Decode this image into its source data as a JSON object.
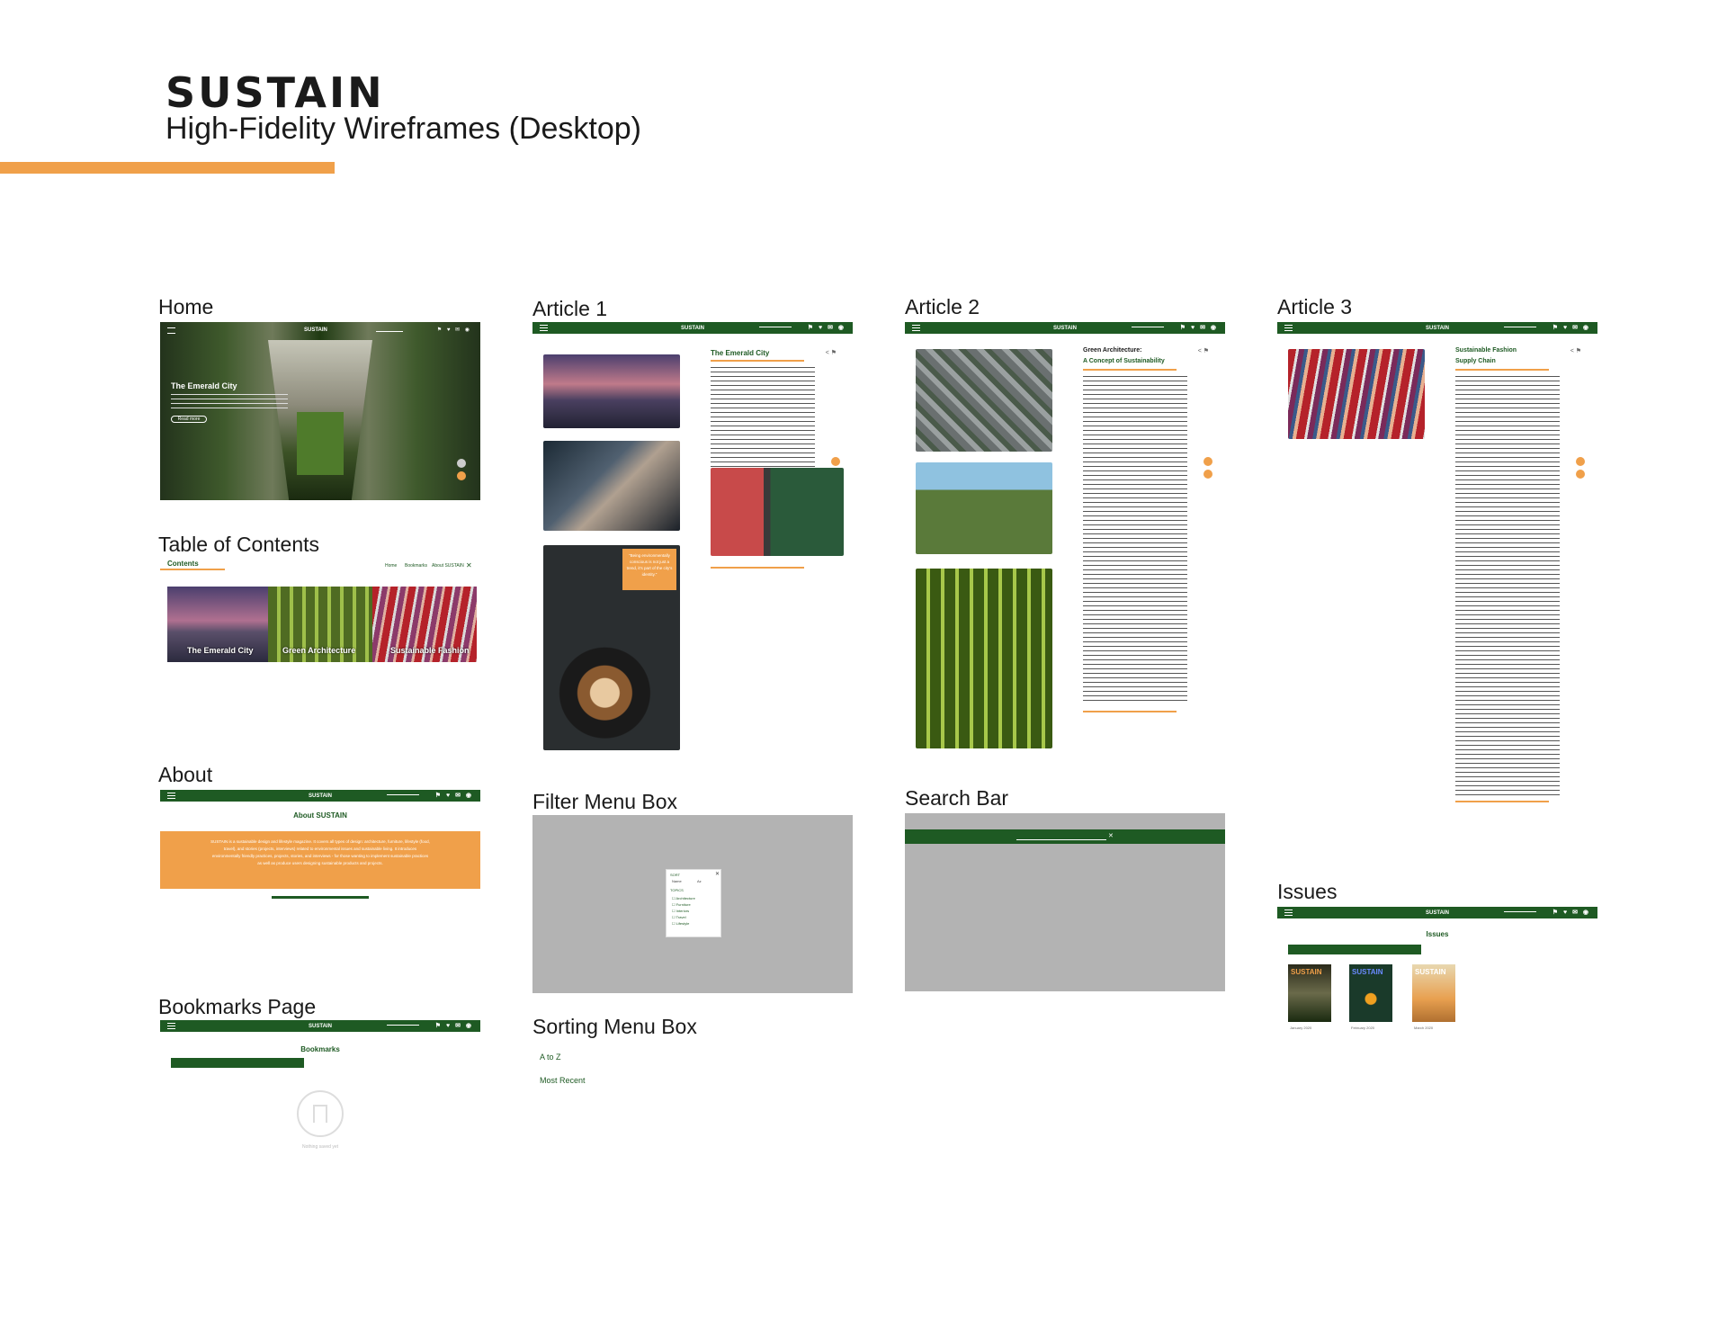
{
  "header": {
    "title": "SUSTAIN",
    "subtitle": "High-Fidelity Wireframes (Desktop)"
  },
  "sections": {
    "home": "Home",
    "toc": "Table of Contents",
    "about": "About",
    "bookmarks": "Bookmarks Page",
    "article1": "Article 1",
    "filter": "Filter Menu Box",
    "sorting": "Sorting Menu Box",
    "article2": "Article 2",
    "search": "Search Bar",
    "article3": "Article 3",
    "issues": "Issues"
  },
  "nav": {
    "brand": "SUSTAIN",
    "icons": "⚑ ♥ ✉ ◉"
  },
  "home": {
    "hero_title": "The Emerald City",
    "button": "Read more"
  },
  "toc": {
    "label": "Contents",
    "links": [
      "Home",
      "Bookmarks",
      "About SUSTAIN"
    ],
    "close": "✕",
    "cards": [
      "The Emerald City",
      "Green Architecture",
      "Sustainable Fashion"
    ]
  },
  "about": {
    "title": "About SUSTAIN",
    "body": "SUSTAIN is a sustainable design and lifestyle magazine. It covers all types of design: architecture, furniture, lifestyle (food, travel), and stories (projects, interviews) related to environmental issues and sustainable living. It introduces environmentally friendly practices, projects, stories, and interviews - for those wanting to implement sustainable practices as well as produce users designing sustainable products and projects."
  },
  "bookmarks": {
    "title": "Bookmarks",
    "empty": "Nothing saved yet"
  },
  "article1": {
    "title": "The Emerald City",
    "quote": "\"Being environmentally conscious is not just a trend, it's part of the city's identity.\""
  },
  "filter": {
    "sort_label": "SORT",
    "sort_opt1": "Name",
    "sort_opt2": "Az",
    "topic_label": "TOPICS",
    "options": [
      "Architecture",
      "Furniture",
      "Interiors",
      "Travel",
      "Lifestyle"
    ],
    "close": "✕"
  },
  "sorting": {
    "options": [
      "A to Z",
      "Most Recent"
    ]
  },
  "article2": {
    "title_line1": "Green Architecture:",
    "title_line2": "A Concept of Sustainability"
  },
  "search": {
    "close": "✕"
  },
  "article3": {
    "title_line1": "Sustainable Fashion",
    "title_line2": "Supply Chain"
  },
  "issues": {
    "title": "Issues",
    "covers": [
      {
        "brand": "SUSTAIN",
        "date": "January 2020"
      },
      {
        "brand": "SUSTAIN",
        "date": "February 2020"
      },
      {
        "brand": "SUSTAIN",
        "date": "March 2020"
      }
    ]
  },
  "colors": {
    "green": "#1e5a23",
    "orange": "#f0a04a",
    "grey": "#b3b3b3"
  }
}
